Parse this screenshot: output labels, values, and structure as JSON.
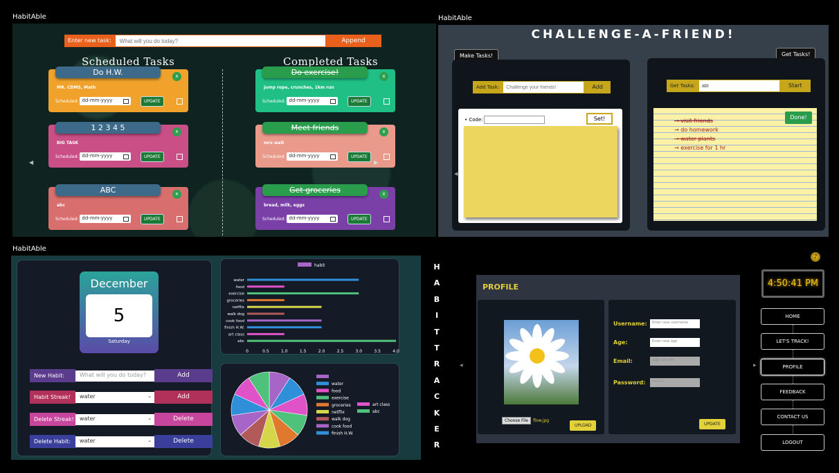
{
  "brand": "HabitAble",
  "q1": {
    "input_label": "Enter new task:",
    "input_placeholder": "What will you do today?",
    "append": "Append",
    "scheduled_heading": "Scheduled Tasks",
    "completed_heading": "Completed Tasks",
    "scheduled_label": "Scheduled:",
    "date_placeholder": "dd-mm-yyyy",
    "update": "UPDATE",
    "x": "x",
    "scheduled": [
      {
        "title": "Do H.W.",
        "desc": "MR. CDMS, Math",
        "color": "#f0a22a",
        "tcolor": "#3e6a8a"
      },
      {
        "title": "1 2 3 4 5",
        "desc": "BIG TASK",
        "color": "#c94f86",
        "tcolor": "#3e6a8a"
      },
      {
        "title": "ABC",
        "desc": "abc",
        "color": "#d96e6e",
        "tcolor": "#3e6a8a"
      }
    ],
    "completed": [
      {
        "title": "Do exercise!",
        "desc": "jump rope, crunches, 1km run",
        "color": "#1fbf86",
        "tcolor": "#2a9d4c"
      },
      {
        "title": "Meet friends",
        "desc": "mrs walt",
        "color": "#e99a8a",
        "tcolor": "#2a9d4c"
      },
      {
        "title": "Get groceries",
        "desc": "bread, milk, eggs",
        "color": "#7b3fa8",
        "tcolor": "#2a9d4c"
      }
    ]
  },
  "q2": {
    "title": "CHALLENGE-A-FRIEND!",
    "make_tab": "Make Tasks!",
    "get_tab": "Get Tasks!",
    "add_label": "Add Task:",
    "add_placeholder": "Challenge your friends!",
    "add_btn": "Add",
    "code_label": "• Code:",
    "set_btn": "Set!",
    "get_label": "Get Tasks:",
    "get_value": "abt",
    "start_btn": "Start",
    "done_btn": "Done!",
    "list": [
      {
        "text": "visit friends",
        "struck": true
      },
      {
        "text": "do homework",
        "struck": false
      },
      {
        "text": "water plants",
        "struck": true
      },
      {
        "text": "exercise for 1 hr",
        "struck": false
      }
    ]
  },
  "q3": {
    "month": "December",
    "day": "5",
    "weekday": "Saturday",
    "rows": [
      {
        "label": "New Habit:",
        "value": "What will you do today?",
        "btn": "Add",
        "c": "#5b3b8c",
        "bc": "#5b3b8c",
        "input": "text"
      },
      {
        "label": "Habit Streak!",
        "value": "water",
        "btn": "Add",
        "c": "#b0315a",
        "bc": "#b0315a",
        "input": "select"
      },
      {
        "label": "Delete Streak!",
        "value": "water",
        "btn": "Delete",
        "c": "#c7459c",
        "bc": "#c7459c",
        "input": "select"
      },
      {
        "label": "Delete Habit:",
        "value": "water",
        "btn": "Delete",
        "c": "#3b3f9c",
        "bc": "#3b3f9c",
        "input": "select"
      }
    ],
    "bar_chart": {
      "type": "bar",
      "legend": "habit",
      "categories": [
        "water",
        "food",
        "exercise",
        "groceries",
        "netflix",
        "walk dog",
        "cook food",
        "finish H.W.",
        "art class",
        "abc"
      ],
      "values": [
        3,
        1,
        3,
        1,
        2,
        1,
        2,
        2,
        1,
        4
      ],
      "colors": [
        "#2f8fd8",
        "#e052c8",
        "#4ec27a",
        "#e0782e",
        "#d6d64a",
        "#b25a5a",
        "#a865c8",
        "#2f8fd8",
        "#e052c8",
        "#4ec27a"
      ],
      "ticks": [
        "0",
        "0.5",
        "1.0",
        "1.5",
        "2.0",
        "2.5",
        "3.0",
        "3.5",
        "4.0"
      ],
      "xlim": [
        0,
        4
      ]
    },
    "pie_chart": {
      "type": "pie",
      "labels": [
        "",
        "water",
        "food",
        "exercise",
        "groceries",
        "netflix",
        "walk dog",
        "cook food",
        "finish H.W.",
        "art class",
        "abc"
      ],
      "values": [
        1,
        1,
        1,
        1,
        1,
        1,
        1,
        1,
        1,
        1,
        1
      ],
      "colors": [
        "#a865c8",
        "#2f8fd8",
        "#e052c8",
        "#4ec27a",
        "#e0782e",
        "#d6d64a",
        "#b25a5a",
        "#a865c8",
        "#2f8fd8",
        "#e052c8",
        "#4ec27a"
      ]
    }
  },
  "q4": {
    "vertical": [
      "H",
      "A",
      "B",
      "I",
      "T",
      "T",
      "R",
      "A",
      "C",
      "K",
      "E",
      "R"
    ],
    "time": "4:50:41 PM",
    "profile": "PROFILE",
    "choose": "Choose File",
    "file": "flow.jpg",
    "upload": "UPLOAD",
    "update": "UPDATE",
    "fields": [
      {
        "label": "Username:",
        "ph": "Enter new username",
        "bg": "#fff"
      },
      {
        "label": "Age:",
        "ph": "Enter new age",
        "bg": "#fff"
      },
      {
        "label": "Email:",
        "ph": "a@b.tal.com",
        "bg": "#aaa"
      },
      {
        "label": "Password:",
        "ph": "••••••",
        "bg": "#aaa"
      }
    ],
    "nav": [
      "HOME",
      "LET'S TRACK!",
      "PROFILE",
      "FEEDBACK",
      "CONTACT US",
      "LOGOUT"
    ]
  }
}
